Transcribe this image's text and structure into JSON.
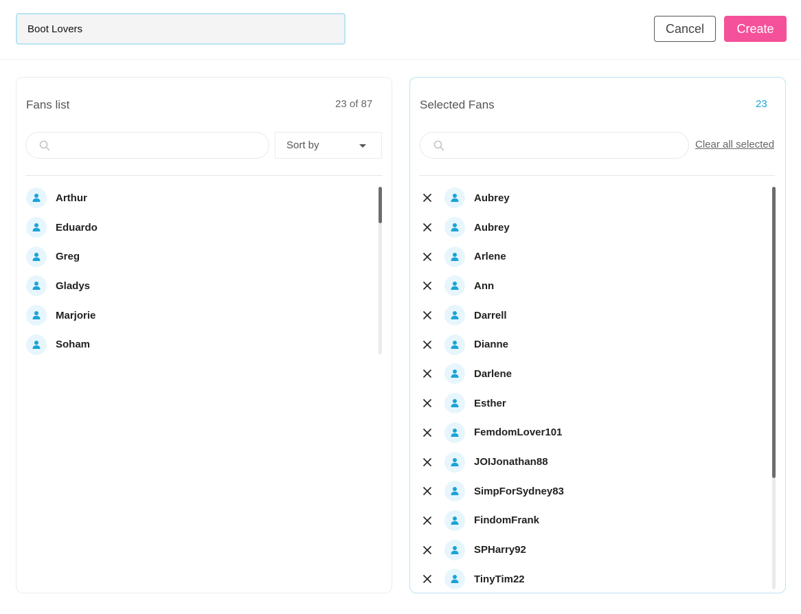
{
  "header": {
    "list_name": "Boot Lovers",
    "cancel_label": "Cancel",
    "create_label": "Create"
  },
  "fans_list": {
    "title": "Fans list",
    "count": "23 of 87",
    "search_placeholder": "",
    "sort_label": "Sort by",
    "items": [
      {
        "name": "Arthur"
      },
      {
        "name": "Eduardo"
      },
      {
        "name": "Greg"
      },
      {
        "name": "Gladys"
      },
      {
        "name": "Marjorie"
      },
      {
        "name": "Soham"
      }
    ]
  },
  "selected_fans": {
    "title": "Selected Fans",
    "count": "23",
    "search_placeholder": "",
    "clear_label": "Clear all selected",
    "items": [
      {
        "name": "Aubrey"
      },
      {
        "name": "Aubrey"
      },
      {
        "name": "Arlene"
      },
      {
        "name": "Ann"
      },
      {
        "name": "Darrell"
      },
      {
        "name": "Dianne"
      },
      {
        "name": "Darlene"
      },
      {
        "name": "Esther"
      },
      {
        "name": "FemdomLover101"
      },
      {
        "name": "JOIJonathan88"
      },
      {
        "name": "SimpForSydney83"
      },
      {
        "name": "FindomFrank"
      },
      {
        "name": "SPHarry92"
      },
      {
        "name": "TinyTim22"
      }
    ]
  },
  "colors": {
    "accent_pink": "#f5519a",
    "accent_blue": "#1aa3d8",
    "avatar_bg": "#e7f6fc"
  },
  "icons": {
    "avatar": "user-icon",
    "search": "search-icon",
    "remove": "close-icon",
    "sort": "caret-down-icon"
  }
}
